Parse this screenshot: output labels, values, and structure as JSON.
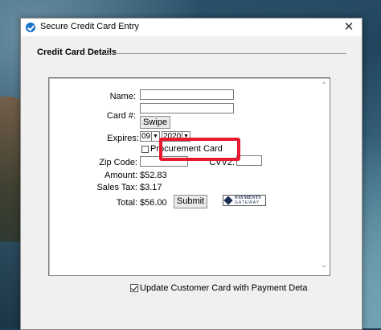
{
  "window": {
    "title": "Secure Credit Card Entry",
    "close": "✕"
  },
  "group": {
    "title": "Credit Card Details"
  },
  "form": {
    "name_label": "Name:",
    "card_label": "Card #:",
    "swipe_button": "Swipe",
    "expires_label": "Expires:",
    "exp_month": "09",
    "exp_year": "2020",
    "procurement_label": "Procurement Card",
    "procurement_checked": false,
    "zip_label": "Zip Code:",
    "cvv_label": "CVV2:",
    "amount_label": "Amount:",
    "amount_value": "$52.83",
    "tax_label": "Sales Tax:",
    "tax_value": "$3.17",
    "total_label": "Total:",
    "total_value": "$56.00",
    "submit_button": "Submit",
    "logo_line1": "PAYMENTS",
    "logo_line2": "GATEWAY"
  },
  "update_checkbox": {
    "label": "Update Customer Card with Payment Deta",
    "checked": true
  },
  "colors": {
    "highlight": "#e8182e",
    "title_icon": "#1a73c9"
  }
}
